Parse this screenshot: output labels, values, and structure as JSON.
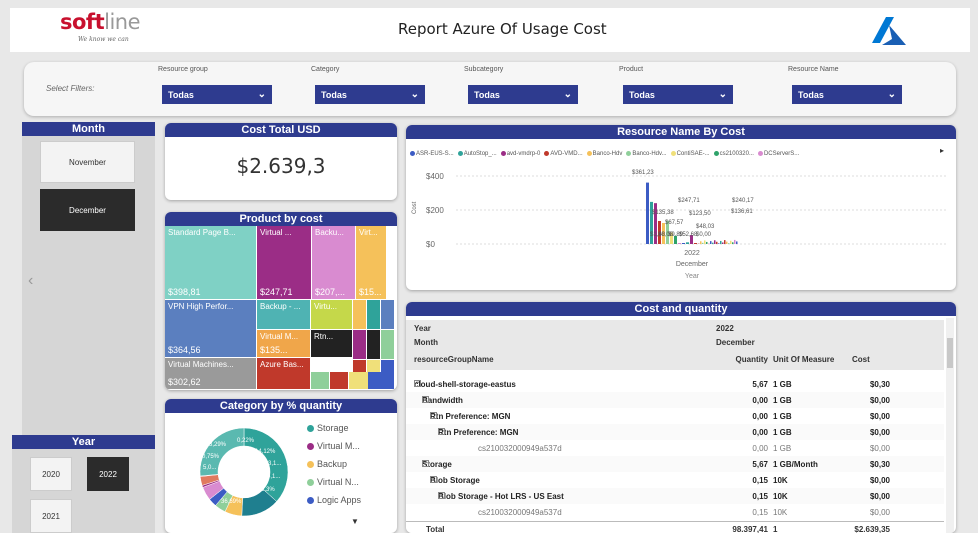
{
  "header": {
    "logo_text_a": "soft",
    "logo_text_b": "line",
    "tagline": "We know we can",
    "title": "Report Azure Of Usage Cost"
  },
  "filters": {
    "label": "Select Filters:",
    "items": [
      {
        "label": "Resource group",
        "value": "Todas"
      },
      {
        "label": "Category",
        "value": "Todas"
      },
      {
        "label": "Subcategory",
        "value": "Todas"
      },
      {
        "label": "Product",
        "value": "Todas"
      },
      {
        "label": "Resource Name",
        "value": "Todas"
      }
    ]
  },
  "month_slicer": {
    "title": "Month",
    "items": [
      {
        "label": "November",
        "selected": false
      },
      {
        "label": "December",
        "selected": true
      }
    ]
  },
  "year_slicer": {
    "title": "Year",
    "items": [
      {
        "label": "2020",
        "selected": false
      },
      {
        "label": "2022",
        "selected": true
      },
      {
        "label": "2021",
        "selected": false
      }
    ]
  },
  "cost_total": {
    "title": "Cost Total USD",
    "value": "$2.639,3"
  },
  "product_by_cost": {
    "title": "Product by cost",
    "tiles": [
      {
        "label": "Standard Page B...",
        "value": "$398,81",
        "color": "#7fd1c5"
      },
      {
        "label": "Virtual ...",
        "value": "$247,71",
        "color": "#9b2d86"
      },
      {
        "label": "Backu...",
        "value": "$207,...",
        "color": "#d98bd0"
      },
      {
        "label": "Virt...",
        "value": "$15...",
        "color": "#f5c15a"
      },
      {
        "label": "VPN High Perfor...",
        "value": "$364,56",
        "color": "#5b7fbf"
      },
      {
        "label": "Backup - ...",
        "value": "",
        "color": "#4fb3b3"
      },
      {
        "label": "Virtu...",
        "value": "",
        "color": "#c5d84a"
      },
      {
        "label": "Virtual M...",
        "value": "$135...",
        "color": "#f0a64a"
      },
      {
        "label": "Rtn...",
        "value": "",
        "color": "#222222"
      },
      {
        "label": "Virtual Machines...",
        "value": "$302,62",
        "color": "#9a9a9a"
      },
      {
        "label": "Azure Bas...",
        "value": "",
        "color": "#c0392b"
      }
    ]
  },
  "category_by_quantity": {
    "title": "Category by % quantity",
    "legend": [
      {
        "label": "Storage",
        "color": "#2fa39a"
      },
      {
        "label": "Virtual M...",
        "color": "#9b2d86"
      },
      {
        "label": "Backup",
        "color": "#f5c15a"
      },
      {
        "label": "Virtual N...",
        "color": "#8fcf9a"
      },
      {
        "label": "Logic Apps",
        "color": "#3c5cc4"
      }
    ],
    "slice_labels": [
      "3,29%",
      "0,22%",
      "0,75%",
      "5,0...",
      "14,12%",
      "3,1...",
      "4,1...",
      "6,3%",
      "36,69%"
    ],
    "slices": [
      {
        "pct": 36.69,
        "color": "#2fa39a"
      },
      {
        "pct": 14.12,
        "color": "#1f7f8f"
      },
      {
        "pct": 6.3,
        "color": "#f5c15a"
      },
      {
        "pct": 4.1,
        "color": "#8fcf9a"
      },
      {
        "pct": 3.1,
        "color": "#3c5cc4"
      },
      {
        "pct": 5.0,
        "color": "#d98bd0"
      },
      {
        "pct": 0.75,
        "color": "#9b2d86"
      },
      {
        "pct": 3.29,
        "color": "#e07a5f"
      },
      {
        "pct": 0.22,
        "color": "#c0392b"
      },
      {
        "pct": 26.43,
        "color": "#5ab9b0"
      }
    ]
  },
  "resource_by_cost": {
    "title": "Resource Name By Cost",
    "legend": [
      {
        "label": "ASR-EUS-S...",
        "color": "#3c5cc4"
      },
      {
        "label": "AutoStop_...",
        "color": "#2fa39a"
      },
      {
        "label": "avd-vmdrp-0",
        "color": "#9b2d86"
      },
      {
        "label": "AVD-VMD...",
        "color": "#c0392b"
      },
      {
        "label": "Banco-Hdv",
        "color": "#f5c15a"
      },
      {
        "label": "Banco-Hdv...",
        "color": "#8fcf9a"
      },
      {
        "label": "ContiSAE-...",
        "color": "#f0e07a"
      },
      {
        "label": "cs2100320...",
        "color": "#2fa36a"
      },
      {
        "label": "DCServerS...",
        "color": "#d98bd0"
      }
    ],
    "y_ticks": [
      "$400",
      "$200",
      "$0"
    ],
    "y_label": "Cost",
    "x_label_1": "2022",
    "x_label_2": "December",
    "x_axis_title": "Year",
    "bar_labels": [
      "$361,23",
      "$247,71",
      "$240,17",
      "$135,38",
      "$123,50",
      "$136,61",
      "$67,57",
      "$48,03",
      "$1,48",
      "$0,08",
      "$9,89",
      "$52,68",
      "$0,00"
    ]
  },
  "chart_data": {
    "type": "bar",
    "title": "Resource Name By Cost",
    "categories": [
      "December 2022"
    ],
    "ylabel": "Cost",
    "xlabel": "Year",
    "ylim": [
      0,
      400
    ],
    "values": [
      361.23,
      247.71,
      240.17,
      135.38,
      123.5,
      136.61,
      67.57,
      48.03,
      1.48,
      0.08,
      9.89,
      52.68,
      0.0
    ]
  },
  "cost_quantity_table": {
    "title": "Cost and quantity",
    "header_rows": [
      {
        "name": "Year",
        "qty": "2022",
        "unit": "",
        "cost": ""
      },
      {
        "name": "Month",
        "qty": "December",
        "unit": "",
        "cost": ""
      }
    ],
    "columns": {
      "name": "resourceGroupName",
      "qty": "Quantity",
      "unit": "Unit Of Measure",
      "cost": "Cost"
    },
    "rows": [
      {
        "name": "cloud-shell-storage-eastus",
        "qty": "5,67",
        "unit": "1 GB",
        "cost": "$0,30",
        "indent": 0,
        "bold": true,
        "expand": "-"
      },
      {
        "name": "Bandwidth",
        "qty": "0,00",
        "unit": "1 GB",
        "cost": "$0,00",
        "indent": 1,
        "bold": true,
        "expand": "-"
      },
      {
        "name": "Rtn Preference: MGN",
        "qty": "0,00",
        "unit": "1 GB",
        "cost": "$0,00",
        "indent": 2,
        "bold": true,
        "expand": "-"
      },
      {
        "name": "Rtn Preference: MGN",
        "qty": "0,00",
        "unit": "1 GB",
        "cost": "$0,00",
        "indent": 3,
        "bold": true,
        "expand": "-"
      },
      {
        "name": "cs210032000949a537d",
        "qty": "0,00",
        "unit": "1 GB",
        "cost": "$0,00",
        "indent": 4,
        "bold": false,
        "expand": ""
      },
      {
        "name": "Storage",
        "qty": "5,67",
        "unit": "1 GB/Month",
        "cost": "$0,30",
        "indent": 1,
        "bold": true,
        "expand": "-"
      },
      {
        "name": "Blob Storage",
        "qty": "0,15",
        "unit": "10K",
        "cost": "$0,00",
        "indent": 2,
        "bold": true,
        "expand": "-"
      },
      {
        "name": "Blob Storage - Hot LRS - US East",
        "qty": "0,15",
        "unit": "10K",
        "cost": "$0,00",
        "indent": 3,
        "bold": true,
        "expand": "-"
      },
      {
        "name": "cs210032000949a537d",
        "qty": "0,15",
        "unit": "10K",
        "cost": "$0,00",
        "indent": 4,
        "bold": false,
        "expand": ""
      }
    ],
    "total": {
      "name": "Total",
      "qty": "98.397,41",
      "unit": "1",
      "cost": "$2.639,35"
    }
  },
  "colors": {
    "brand_navy": "#2e3b8f",
    "brand_red": "#c8102e",
    "azure_blue": "#0078d4"
  },
  "icons": [
    "azure-logo-icon",
    "chevron-down-icon",
    "chevron-left-icon",
    "chevron-right-icon",
    "expand-minus-icon"
  ]
}
